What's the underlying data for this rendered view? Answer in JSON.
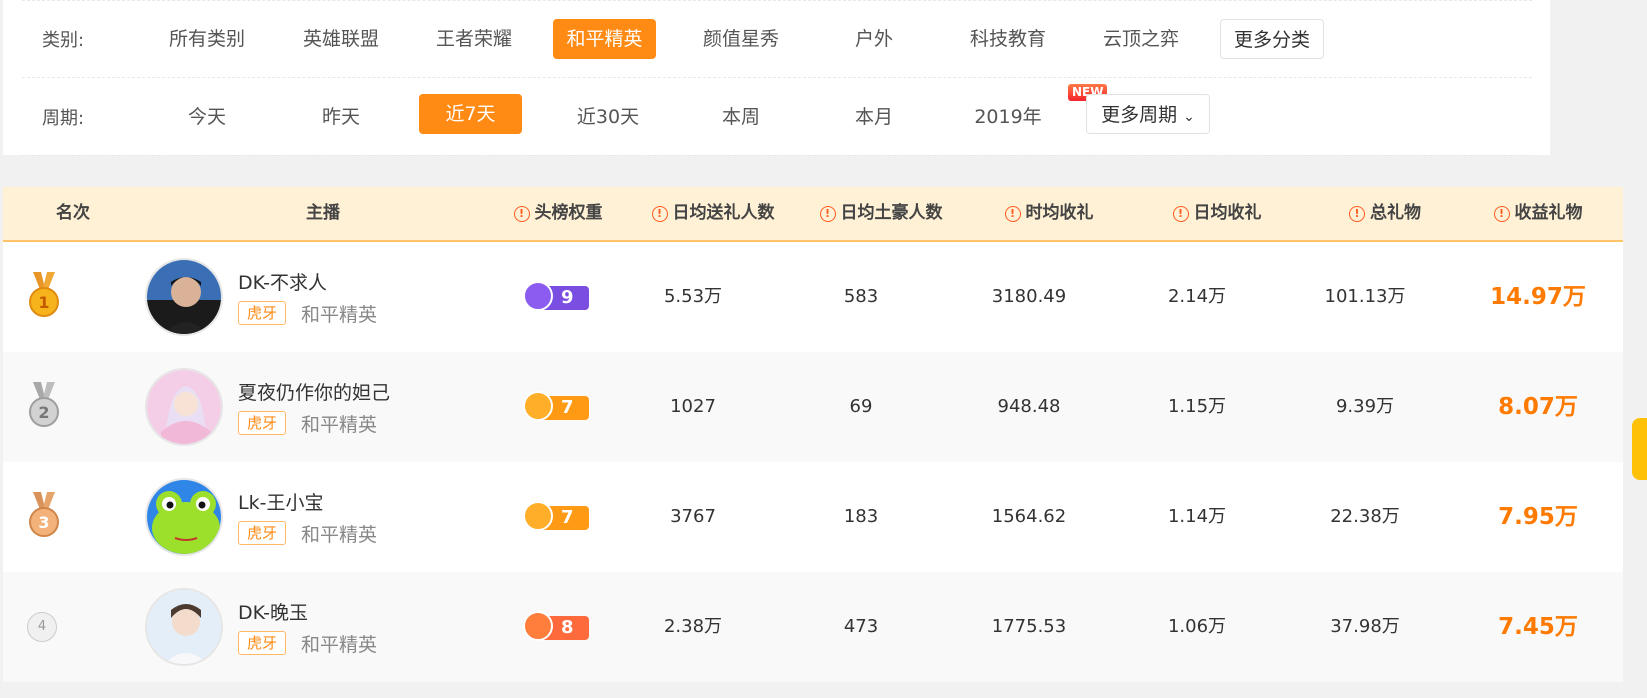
{
  "filters": {
    "category_label": "类别:",
    "categories": [
      {
        "label": "所有类别",
        "active": false
      },
      {
        "label": "英雄联盟",
        "active": false
      },
      {
        "label": "王者荣耀",
        "active": false
      },
      {
        "label": "和平精英",
        "active": true
      },
      {
        "label": "颜值星秀",
        "active": false
      },
      {
        "label": "户外",
        "active": false
      },
      {
        "label": "科技教育",
        "active": false
      },
      {
        "label": "云顶之弈",
        "active": false
      }
    ],
    "more_categories": "更多分类",
    "period_label": "周期:",
    "periods": [
      {
        "label": "今天",
        "active": false
      },
      {
        "label": "昨天",
        "active": false
      },
      {
        "label": "近7天",
        "active": true
      },
      {
        "label": "近30天",
        "active": false
      },
      {
        "label": "本周",
        "active": false
      },
      {
        "label": "本月",
        "active": false
      },
      {
        "label": "2019年",
        "active": false
      }
    ],
    "new_badge": "NEW",
    "more_periods": "更多周期"
  },
  "table": {
    "headers": {
      "rank": "名次",
      "anchor": "主播",
      "top_weight": "头榜权重",
      "daily_gifters": "日均送礼人数",
      "daily_tycoons": "日均土豪人数",
      "hourly_income": "时均收礼",
      "daily_income": "日均收礼",
      "total_gifts": "总礼物",
      "income_gifts": "收益礼物"
    },
    "rows": [
      {
        "rank": "1",
        "name": "DK-不求人",
        "platform": "虎牙",
        "category": "和平精英",
        "weight": "9",
        "weight_style": "purple",
        "daily_gifters": "5.53万",
        "daily_tycoons": "583",
        "hourly_income": "3180.49",
        "daily_income": "2.14万",
        "total_gifts": "101.13万",
        "income_gifts": "14.97万"
      },
      {
        "rank": "2",
        "name": "夏夜仍作你的妲己",
        "platform": "虎牙",
        "category": "和平精英",
        "weight": "7",
        "weight_style": "orange",
        "daily_gifters": "1027",
        "daily_tycoons": "69",
        "hourly_income": "948.48",
        "daily_income": "1.15万",
        "total_gifts": "9.39万",
        "income_gifts": "8.07万"
      },
      {
        "rank": "3",
        "name": "Lk-王小宝",
        "platform": "虎牙",
        "category": "和平精英",
        "weight": "7",
        "weight_style": "orange",
        "daily_gifters": "3767",
        "daily_tycoons": "183",
        "hourly_income": "1564.62",
        "daily_income": "1.14万",
        "total_gifts": "22.38万",
        "income_gifts": "7.95万"
      },
      {
        "rank": "4",
        "name": "DK-晚玉",
        "platform": "虎牙",
        "category": "和平精英",
        "weight": "8",
        "weight_style": "red",
        "daily_gifters": "2.38万",
        "daily_tycoons": "473",
        "hourly_income": "1775.53",
        "daily_income": "1.06万",
        "total_gifts": "37.98万",
        "income_gifts": "7.45万"
      }
    ]
  },
  "colors": {
    "accent": "#ff8a14",
    "header_bg": "#fff1d6",
    "gift_text": "#ff7a00"
  }
}
